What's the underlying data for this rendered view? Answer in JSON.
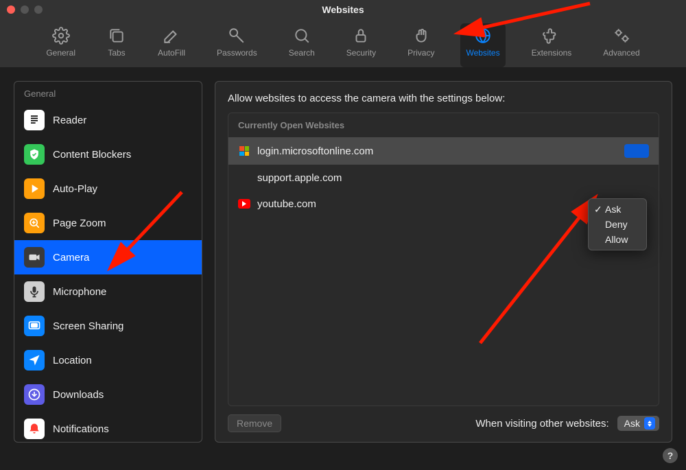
{
  "window": {
    "title": "Websites"
  },
  "toolbar": {
    "items": [
      {
        "label": "General"
      },
      {
        "label": "Tabs"
      },
      {
        "label": "AutoFill"
      },
      {
        "label": "Passwords"
      },
      {
        "label": "Search"
      },
      {
        "label": "Security"
      },
      {
        "label": "Privacy"
      },
      {
        "label": "Websites"
      },
      {
        "label": "Extensions"
      },
      {
        "label": "Advanced"
      }
    ],
    "activeIndex": 7
  },
  "sidebar": {
    "header": "General",
    "items": [
      {
        "label": "Reader"
      },
      {
        "label": "Content Blockers"
      },
      {
        "label": "Auto-Play"
      },
      {
        "label": "Page Zoom"
      },
      {
        "label": "Camera"
      },
      {
        "label": "Microphone"
      },
      {
        "label": "Screen Sharing"
      },
      {
        "label": "Location"
      },
      {
        "label": "Downloads"
      },
      {
        "label": "Notifications"
      }
    ],
    "selectedIndex": 4
  },
  "main": {
    "heading": "Allow websites to access the camera with the settings below:",
    "listHeader": "Currently Open Websites",
    "sites": [
      {
        "host": "login.microsoftonline.com"
      },
      {
        "host": "support.apple.com"
      },
      {
        "host": "youtube.com"
      }
    ],
    "selectedSiteIndex": 0,
    "removeLabel": "Remove",
    "otherLabel": "When visiting other websites:",
    "otherValue": "Ask"
  },
  "dropdown": {
    "items": [
      {
        "label": "Ask",
        "checked": true
      },
      {
        "label": "Deny",
        "checked": false
      },
      {
        "label": "Allow",
        "checked": false
      }
    ]
  },
  "help": {
    "glyph": "?"
  }
}
